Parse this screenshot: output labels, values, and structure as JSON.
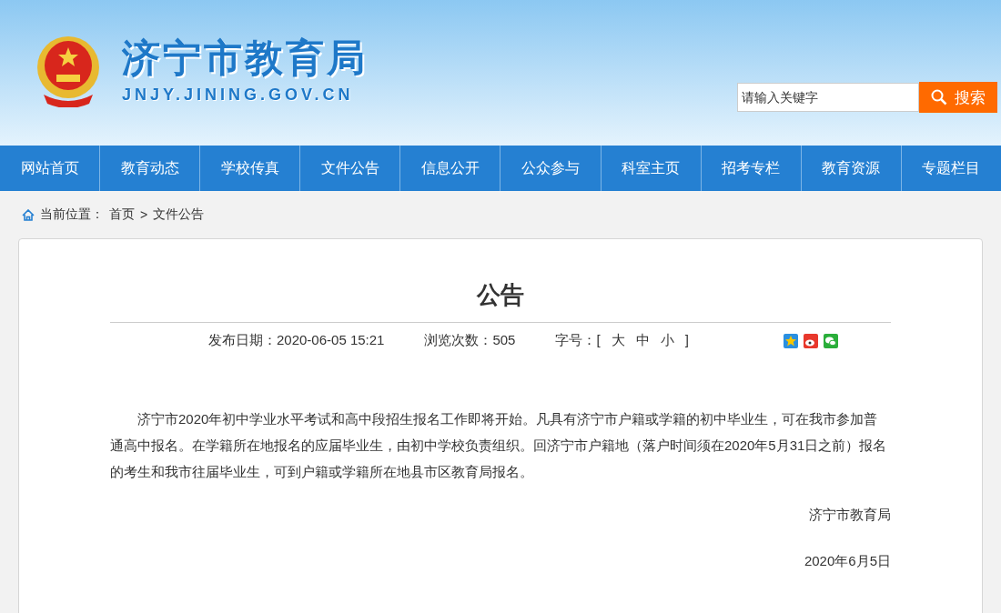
{
  "header": {
    "site_title": "济宁市教育局",
    "site_url": "JNJY.JINING.GOV.CN",
    "search": {
      "placeholder": "请输入关键字",
      "button": "搜索"
    }
  },
  "nav": [
    "网站首页",
    "教育动态",
    "学校传真",
    "文件公告",
    "信息公开",
    "公众参与",
    "科室主页",
    "招考专栏",
    "教育资源",
    "专题栏目"
  ],
  "breadcrumb": {
    "label": "当前位置：",
    "links": [
      "首页",
      "文件公告"
    ],
    "separator": ">"
  },
  "article": {
    "title": "公告",
    "published": "发布日期：2020-06-05 15:21",
    "views": "浏览次数：505",
    "font_size_label": "字号：[",
    "font_sizes": [
      "大",
      "中",
      "小"
    ],
    "font_size_close": "]",
    "paragraph": "济宁市2020年初中学业水平考试和高中段招生报名工作即将开始。凡具有济宁市户籍或学籍的初中毕业生，可在我市参加普通高中报名。在学籍所在地报名的应届毕业生，由初中学校负责组织。回济宁市户籍地（落户时间须在2020年5月31日之前）报名的考生和我市往届毕业生，可到户籍或学籍所在地县市区教育局报名。",
    "signature": "济宁市教育局",
    "date": "2020年6月5日"
  }
}
